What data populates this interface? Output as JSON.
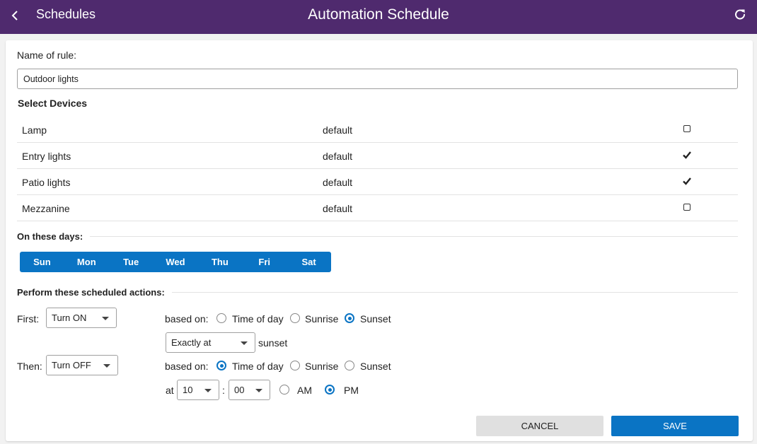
{
  "header": {
    "back_label": "Schedules",
    "title": "Automation Schedule",
    "back_icon": "chevron-left-icon",
    "refresh_icon": "refresh-icon"
  },
  "rule": {
    "name_label": "Name of rule:",
    "name_value": "Outdoor lights"
  },
  "devices": {
    "heading": "Select Devices",
    "items": [
      {
        "name": "Lamp",
        "scene": "default",
        "selected": false
      },
      {
        "name": "Entry lights",
        "scene": "default",
        "selected": true
      },
      {
        "name": "Patio lights",
        "scene": "default",
        "selected": true
      },
      {
        "name": "Mezzanine",
        "scene": "default",
        "selected": false
      }
    ]
  },
  "days": {
    "heading": "On these days:",
    "items": [
      "Sun",
      "Mon",
      "Tue",
      "Wed",
      "Thu",
      "Fri",
      "Sat"
    ]
  },
  "actions": {
    "heading": "Perform these scheduled actions:",
    "first": {
      "label": "First:",
      "action": "Turn ON",
      "based_on_label": "based on:",
      "options": [
        "Time of day",
        "Sunrise",
        "Sunset"
      ],
      "selected": "Sunset",
      "offset": "Exactly at",
      "offset_suffix": "sunset"
    },
    "then": {
      "label": "Then:",
      "action": "Turn OFF",
      "based_on_label": "based on:",
      "options": [
        "Time of day",
        "Sunrise",
        "Sunset"
      ],
      "selected": "Time of day",
      "at_label": "at",
      "hour": "10",
      "separator": ":",
      "minute": "00",
      "am_label": "AM",
      "pm_label": "PM",
      "meridiem": "PM"
    }
  },
  "buttons": {
    "cancel": "CANCEL",
    "save": "SAVE"
  },
  "colors": {
    "header_bg": "#4f2a6e",
    "accent": "#0a74c4",
    "cancel_bg": "#e0e0e0"
  }
}
